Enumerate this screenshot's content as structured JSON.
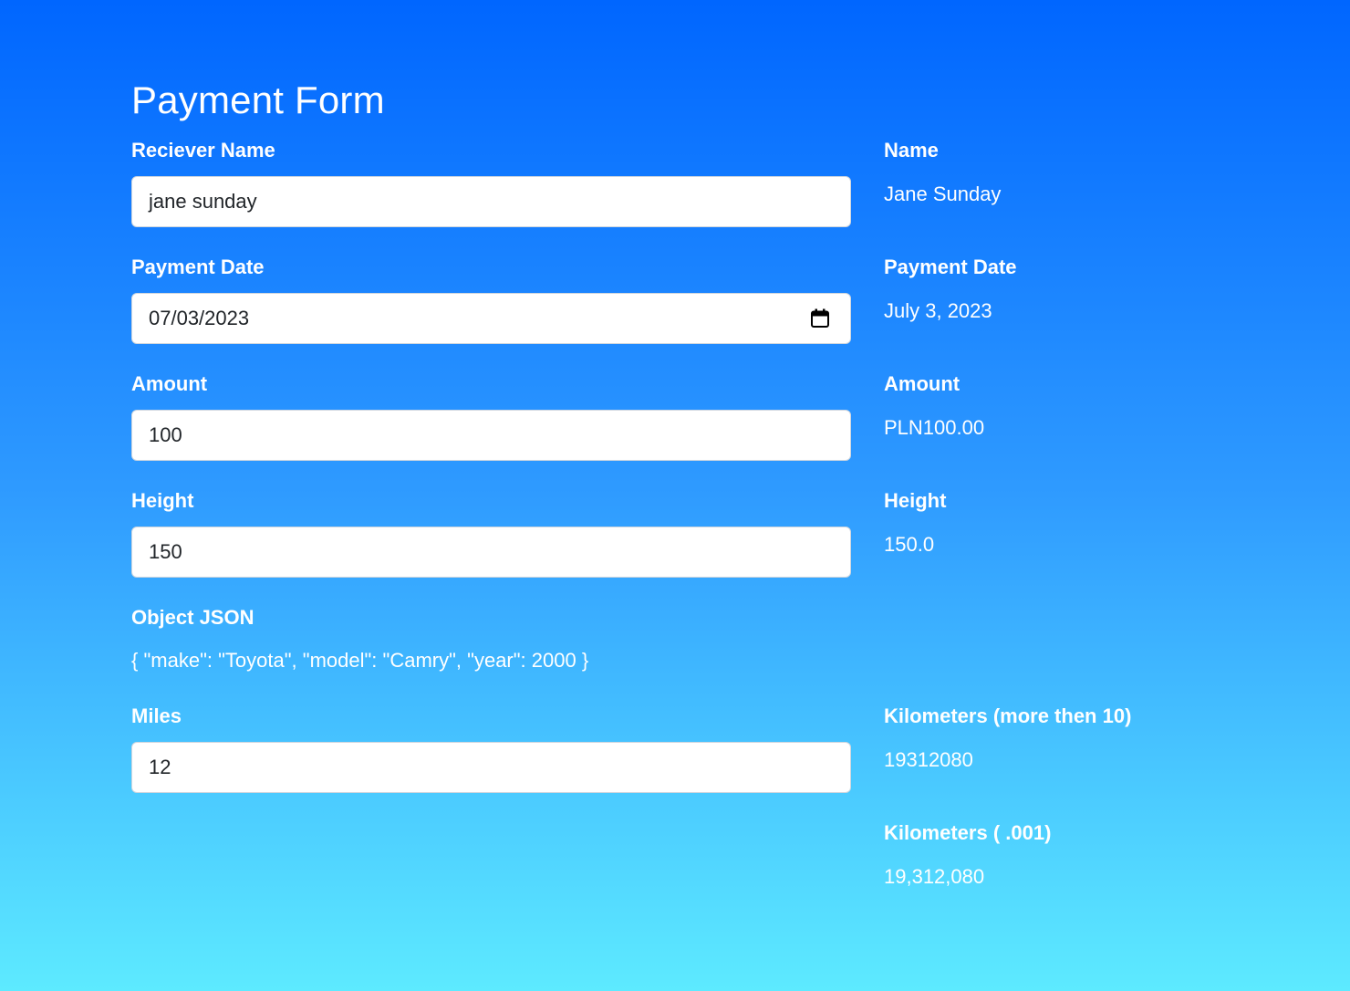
{
  "form": {
    "title": "Payment Form",
    "receiver_name": {
      "label": "Reciever Name",
      "value": "jane sunday"
    },
    "payment_date": {
      "label": "Payment Date",
      "value": "07/03/2023"
    },
    "amount": {
      "label": "Amount",
      "value": "100"
    },
    "height": {
      "label": "Height",
      "value": "150"
    },
    "object_json": {
      "label": "Object JSON",
      "value": "{ \"make\": \"Toyota\", \"model\": \"Camry\", \"year\": 2000 }"
    },
    "miles": {
      "label": "Miles",
      "value": "12"
    }
  },
  "output": {
    "name": {
      "label": "Name",
      "value": "Jane Sunday"
    },
    "payment_date": {
      "label": "Payment Date",
      "value": "July 3, 2023"
    },
    "amount": {
      "label": "Amount",
      "value": "PLN100.00"
    },
    "height": {
      "label": "Height",
      "value": "150.0"
    },
    "kilometers_more": {
      "label": "Kilometers (more then 10)",
      "value": "19312080"
    },
    "kilometers_001": {
      "label": "Kilometers ( .001)",
      "value": "19,312,080"
    }
  },
  "icons": {
    "payment_date_picker": "calendar-icon"
  }
}
